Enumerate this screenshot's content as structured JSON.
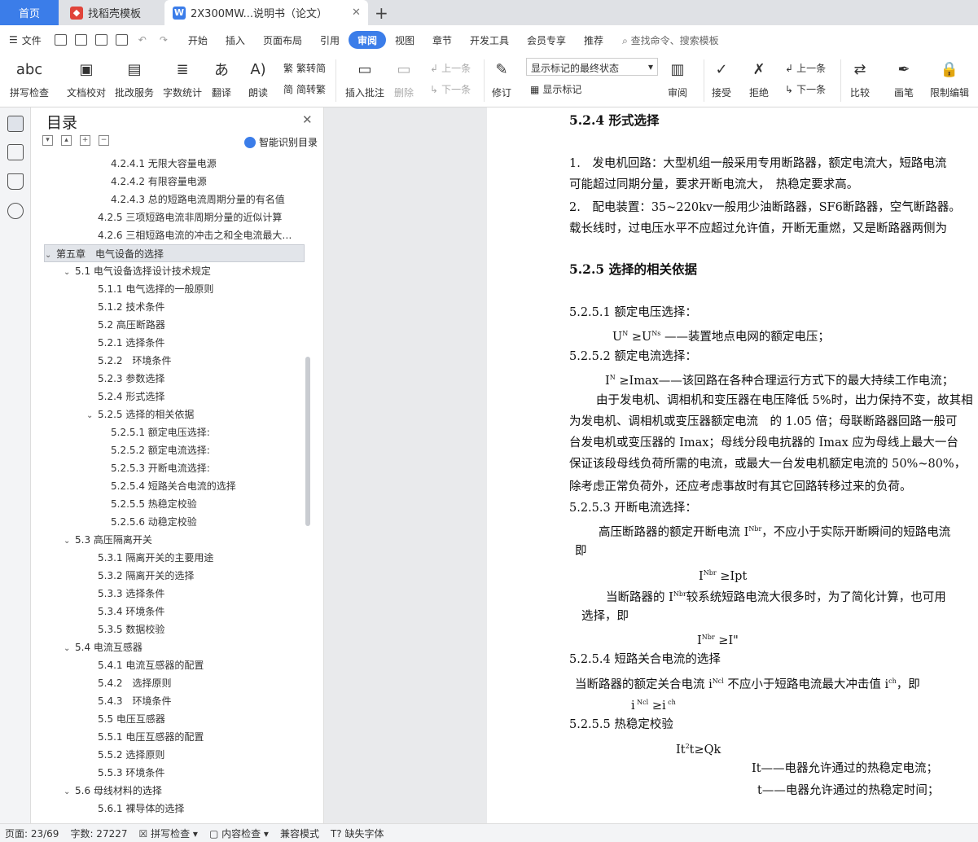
{
  "tabs": {
    "home": "首页",
    "tab2": "找稻壳模板",
    "tab3": "2X300MW...说明书（论文）"
  },
  "menu": {
    "file": "文件",
    "items": [
      "开始",
      "插入",
      "页面布局",
      "引用",
      "审阅",
      "视图",
      "章节",
      "开发工具",
      "会员专享",
      "推荐"
    ],
    "active": "审阅",
    "search": "查找命令、搜索模板"
  },
  "ribbon": {
    "spell": "拼写检查",
    "doccheck": "文档校对",
    "batch": "批改服务",
    "wordcount": "字数统计",
    "translate": "翻译",
    "read": "朗读",
    "trad": "繁转简",
    "simp": "简转繁",
    "addcomment": "插入批注",
    "delete": "删除",
    "prev": "上一条",
    "next": "下一条",
    "revise": "修订",
    "markup_state": "显示标记的最终状态",
    "show_markup": "显示标记",
    "review": "审阅",
    "accept": "接受",
    "reject": "拒绝",
    "prev2": "上一条",
    "next2": "下一条",
    "compare": "比较",
    "pen": "画笔",
    "restrict": "限制编辑"
  },
  "nav": {
    "title": "目录",
    "smart": "智能识别目录",
    "items": [
      {
        "t": "4.2.4.1 无限大容量电源",
        "lv": 3
      },
      {
        "t": "4.2.4.2 有限容量电源",
        "lv": 3
      },
      {
        "t": "4.2.4.3 总的短路电流周期分量的有名值",
        "lv": 3
      },
      {
        "t": "4.2.5 三项短路电流非周期分量的近似计算",
        "lv": 2
      },
      {
        "t": "4.2.6 三相短路电流的冲击之和全电流最大有效...",
        "lv": 2
      },
      {
        "t": "第五章　电气设备的选择",
        "lv": 0,
        "c": true,
        "sel": true
      },
      {
        "t": "5.1 电气设备选择设计技术规定",
        "lv": 1,
        "c": true
      },
      {
        "t": "5.1.1 电气选择的一般原则",
        "lv": 2
      },
      {
        "t": "5.1.2 技术条件",
        "lv": 2
      },
      {
        "t": "5.2 高压断路器",
        "lv": 2
      },
      {
        "t": "5.2.1 选择条件",
        "lv": 2
      },
      {
        "t": "5.2.2　环境条件",
        "lv": 2
      },
      {
        "t": "5.2.3 参数选择",
        "lv": 2
      },
      {
        "t": "5.2.4 形式选择",
        "lv": 2
      },
      {
        "t": "5.2.5 选择的相关依据",
        "lv": 2,
        "c": true
      },
      {
        "t": "5.2.5.1 额定电压选择:",
        "lv": 3
      },
      {
        "t": "5.2.5.2 额定电流选择:",
        "lv": 3
      },
      {
        "t": "5.2.5.3 开断电流选择:",
        "lv": 3
      },
      {
        "t": "5.2.5.4 短路关合电流的选择",
        "lv": 3
      },
      {
        "t": "5.2.5.5 热稳定校验",
        "lv": 3
      },
      {
        "t": "5.2.5.6 动稳定校验",
        "lv": 3
      },
      {
        "t": "5.3 高压隔离开关",
        "lv": 1,
        "c": true
      },
      {
        "t": "5.3.1 隔离开关的主要用途",
        "lv": 2
      },
      {
        "t": "5.3.2 隔离开关的选择",
        "lv": 2
      },
      {
        "t": "5.3.3 选择条件",
        "lv": 2
      },
      {
        "t": "5.3.4 环境条件",
        "lv": 2
      },
      {
        "t": "5.3.5 数据校验",
        "lv": 2
      },
      {
        "t": "5.4 电流互感器",
        "lv": 1,
        "c": true
      },
      {
        "t": "5.4.1 电流互感器的配置",
        "lv": 2
      },
      {
        "t": "5.4.2　选择原则",
        "lv": 2
      },
      {
        "t": "5.4.3　环境条件",
        "lv": 2
      },
      {
        "t": "5.5 电压互感器",
        "lv": 2
      },
      {
        "t": "5.5.1 电压互感器的配置",
        "lv": 2
      },
      {
        "t": "5.5.2 选择原则",
        "lv": 2
      },
      {
        "t": "5.5.3 环境条件",
        "lv": 2
      },
      {
        "t": "5.6 母线材料的选择",
        "lv": 1,
        "c": true
      },
      {
        "t": "5.6.1 裸导体的选择",
        "lv": 2
      }
    ]
  },
  "doc": {
    "h524": "5.2.4 形式选择",
    "p1": "1.　发电机回路：大型机组一般采用专用断路器，额定电流大，短路电流",
    "p1b": "可能超过同期分量，要求开断电流大，　热稳定要求高。",
    "p2": "2.　配电装置：35~220kv一般用少油断路器，SF6断路器，空气断路器。",
    "p2b": "载长线时，过电压水平不应超过允许值，开断无重燃，又是断路器两侧为",
    "h525": "5.2.5 选择的相关依据",
    "s1": "5.2.5.1 额定电压选择：",
    "f1": "——装置地点电网的额定电压；",
    "s2": "5.2.5.2 额定电流选择：",
    "f2": "≥Imax——该回路在各种合理运行方式下的最大持续工作电流；",
    "p3": "由于发电机、调相机和变压器在电压降低 5%时，出力保持不变，故其相",
    "p4": "为发电机、调相机或变压器额定电流　的 1.05 倍；母联断路器回路一般可",
    "p5": "台发电机或变压器的 Imax；母线分段电抗器的 Imax 应为母线上最大一台",
    "p6": "保证该段母线负荷所需的电流，或最大一台发电机额定电流的 50%~80%，",
    "p7": "除考虑正常负荷外，还应考虑事故时有其它回路转移过来的负荷。",
    "s3": "5.2.5.3 开断电流选择：",
    "p8a": "高压断路器的额定开断电流 I",
    "p8b": "，不应小于实际开断瞬间的短路电流",
    "p9": "即",
    "f3": "≥Ipt",
    "p10a": "当断路器的 I",
    "p10b": "较系统短路电流大很多时，为了简化计算，也可用",
    "p11": "选择，即",
    "f4": "≥I\"",
    "s4": "5.2.5.4 短路关合电流的选择",
    "p12a": "当断路器的额定关合电流 i",
    "p12b": "不应小于短路电流最大冲击值 i",
    "p12c": "，即",
    "s5": "5.2.5.5 热稳定校验",
    "f6": "t≥Qk",
    "d1": "It——电器允许通过的热稳定电流；",
    "d2": "t——电器允许通过的热稳定时间；"
  },
  "status": {
    "page": "页面: 23/69",
    "words": "字数: 27227",
    "spell": "拼写检查",
    "content": "内容检查",
    "compat": "兼容模式",
    "font": "缺失字体"
  }
}
